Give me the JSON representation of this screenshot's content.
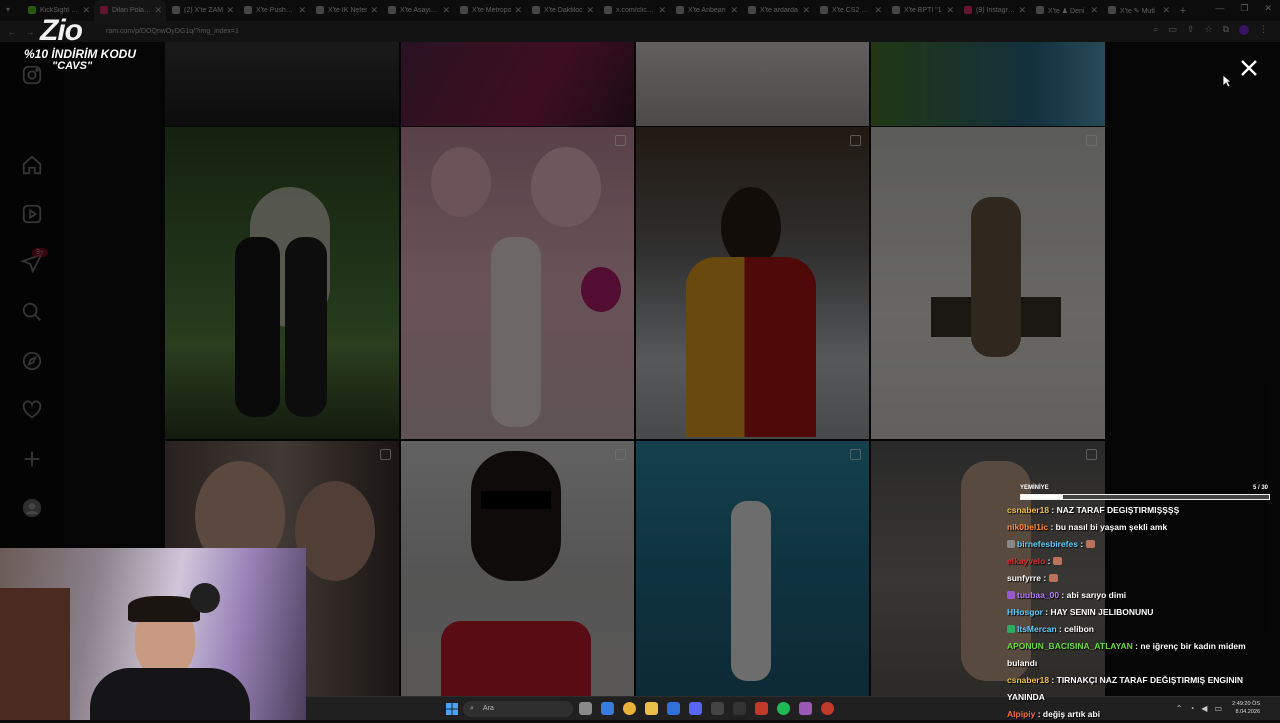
{
  "browser": {
    "tabs": [
      {
        "title": "KickSight Lin",
        "active": false,
        "color": "#53c41b"
      },
      {
        "title": "Dilan Polat Y",
        "active": true,
        "color": "#e1306c"
      },
      {
        "title": "(2) X'te ZAM",
        "active": false,
        "color": "#999999"
      },
      {
        "title": "X'te Pusholde",
        "active": false,
        "color": "#999999"
      },
      {
        "title": "X'te İK Nefer",
        "active": false,
        "color": "#999999"
      },
      {
        "title": "X'te Asayiş B",
        "active": false,
        "color": "#999999"
      },
      {
        "title": "X'te Metropo",
        "active": false,
        "color": "#999999"
      },
      {
        "title": "X'te Daktiloc",
        "active": false,
        "color": "#999999"
      },
      {
        "title": "x.com/clicksp",
        "active": false,
        "color": "#999999"
      },
      {
        "title": "X'te Anbean",
        "active": false,
        "color": "#999999"
      },
      {
        "title": "X'te ardarda",
        "active": false,
        "color": "#999999"
      },
      {
        "title": "X'te CS2 Con",
        "active": false,
        "color": "#999999"
      },
      {
        "title": "X'te BPTI \"1",
        "active": false,
        "color": "#999999"
      },
      {
        "title": "(9) Instagram",
        "active": false,
        "color": "#e1306c"
      },
      {
        "title": "X'te ♟ Deni",
        "active": false,
        "color": "#999999"
      },
      {
        "title": "X'te ✎ Mutl",
        "active": false,
        "color": "#999999"
      }
    ],
    "url": "ram.com/p/DOQnwOyDG1q/?img_index=1"
  },
  "overlay": {
    "logo_text": "Zio",
    "promo_line1": "%10 İNDİRİM KODU",
    "promo_line2": "\"CAVS\""
  },
  "instagram": {
    "sidebar_badge": "9+",
    "sidebar_icons": [
      "instagram-logo-icon",
      "home-icon",
      "reels-icon",
      "messages-icon",
      "search-icon",
      "explore-icon",
      "heart-icon",
      "create-icon",
      "profile-avatar-icon"
    ]
  },
  "chat": {
    "title": "YEMİNİYE",
    "count": "5 / 30",
    "progress": 0.17,
    "messages": [
      {
        "user": "csnaber18",
        "color": "#f0c040",
        "text": "NAZ TARAF DEGIŞTIRMIŞŞŞŞ",
        "emote": false
      },
      {
        "user": "nik0bel1ic",
        "color": "#ff8c3a",
        "text": "bu nasıl bi yaşam şekli amk",
        "emote": false
      },
      {
        "user": "birnefesbirefes",
        "color": "#5ad1ff",
        "text": "",
        "emote": true,
        "badge": "#888888"
      },
      {
        "user": "elkayvelo",
        "color": "#e03030",
        "text": "",
        "emote": true
      },
      {
        "user": "sunfyrre",
        "color": "#ffffff",
        "text": "",
        "emote": true
      },
      {
        "user": "tuubaa_00",
        "color": "#b57cff",
        "text": "abi sarıyo dimi",
        "emote": false,
        "badge": "#9b59d0"
      },
      {
        "user": "HHosgor",
        "color": "#5ad1ff",
        "text": "HAY SENIN JELIBONUNU",
        "emote": false
      },
      {
        "user": "ItsMercan",
        "color": "#5ad1ff",
        "text": "celibon",
        "emote": false,
        "badge": "#27ae60"
      },
      {
        "user": "APONUN_BACISINA_ATLAYAN",
        "color": "#6bdc3a",
        "text": "ne iğrenç bir kadın midem bulandı",
        "emote": false
      },
      {
        "user": "csnaber18",
        "color": "#f0c040",
        "text": "TIRNAKÇI NAZ TARAF DEĞIŞTIRMIŞ ENGININ YANINDA",
        "emote": false
      },
      {
        "user": "Alpipiy",
        "color": "#ff6a3a",
        "text": "değiş artık abi",
        "emote": false
      }
    ]
  },
  "taskbar": {
    "search_placeholder": "Ara",
    "time": "2:49:20 ÖS",
    "date": "8.04.2026"
  }
}
